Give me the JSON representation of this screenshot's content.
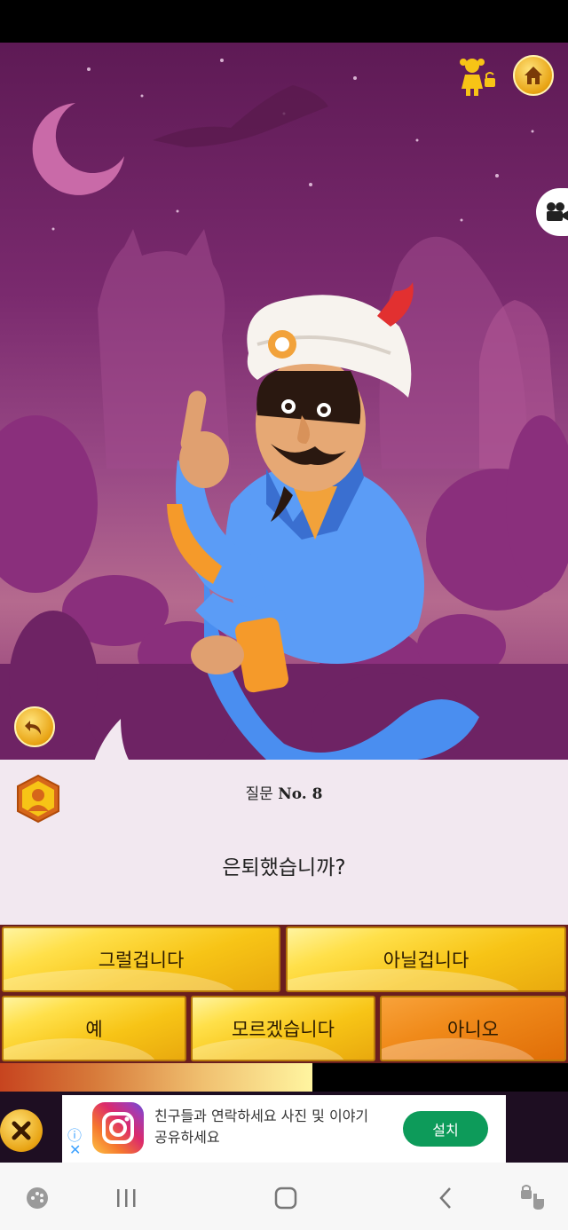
{
  "question": {
    "prefix": "질문",
    "number_label": "No. 8",
    "text": "은퇴했습니까?"
  },
  "answers": [
    {
      "label": "그럴겁니다"
    },
    {
      "label": "아닐겁니다"
    },
    {
      "label": "예"
    },
    {
      "label": "모르겠습니다"
    },
    {
      "label": "아니오"
    }
  ],
  "progress": {
    "fraction": 0.55
  },
  "ad": {
    "text": "친구들과 연락하세요 사진 및 이야기 공유하세요",
    "install_label": "설치"
  },
  "icons": {
    "home": "home-icon",
    "kid_mode": "kid-lock-icon",
    "video": "video-camera-icon",
    "undo": "undo-icon",
    "badge": "profile-badge-icon",
    "close_ad": "close-icon"
  },
  "colors": {
    "scene_top": "#5e1a55",
    "button_yellow": "#f7c416",
    "button_orange": "#f08a1a",
    "panel_bg": "#f2e8f0",
    "install_green": "#0d9b5a"
  }
}
